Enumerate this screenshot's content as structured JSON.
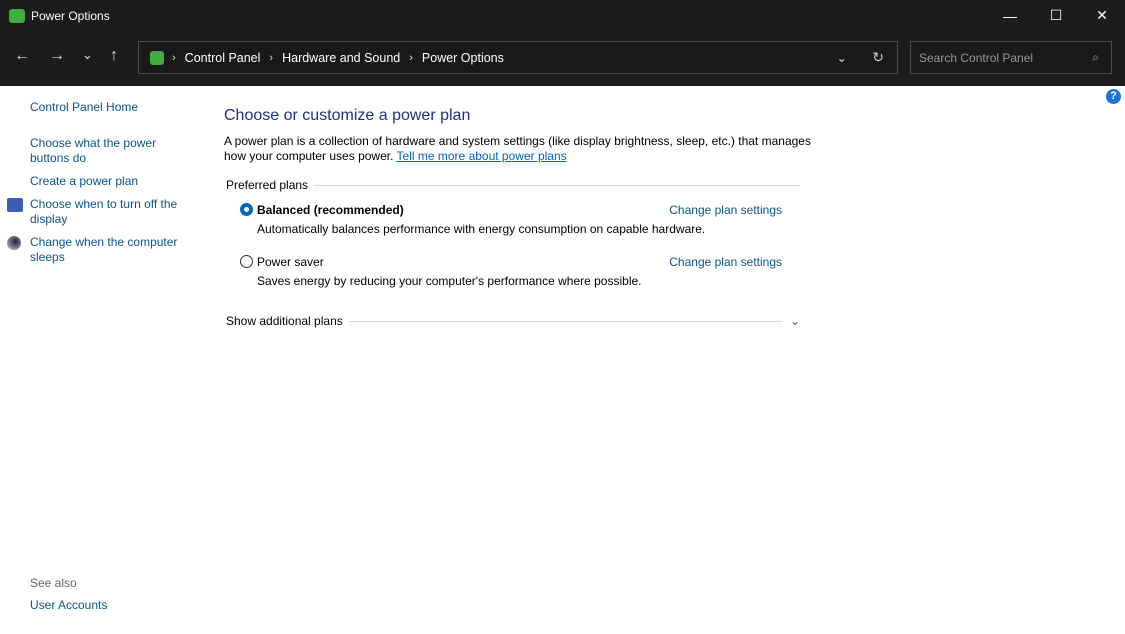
{
  "window": {
    "title": "Power Options",
    "minimize": "—",
    "maximize": "☐",
    "close": "✕"
  },
  "nav": {
    "back": "←",
    "forward": "→",
    "recent": "⌄",
    "up": "↑",
    "breadcrumbs": [
      "Control Panel",
      "Hardware and Sound",
      "Power Options"
    ],
    "search_placeholder": "Search Control Panel"
  },
  "sidebar": {
    "home": "Control Panel Home",
    "items": [
      "Choose what the power buttons do",
      "Create a power plan",
      "Choose when to turn off the display",
      "Change when the computer sleeps"
    ],
    "see_also": "See also",
    "user_accounts": "User Accounts"
  },
  "main": {
    "title": "Choose or customize a power plan",
    "desc": "A power plan is a collection of hardware and system settings (like display brightness, sleep, etc.) that manages how your computer uses power.",
    "learn_link": "Tell me more about power plans",
    "preferred": "Preferred plans",
    "plans": [
      {
        "name": "Balanced (recommended)",
        "selected": true,
        "desc": "Automatically balances performance with energy consumption on capable hardware.",
        "link": "Change plan settings"
      },
      {
        "name": "Power saver",
        "selected": false,
        "desc": "Saves energy by reducing your computer's performance where possible.",
        "link": "Change plan settings"
      }
    ],
    "additional": "Show additional plans",
    "help": "?"
  }
}
